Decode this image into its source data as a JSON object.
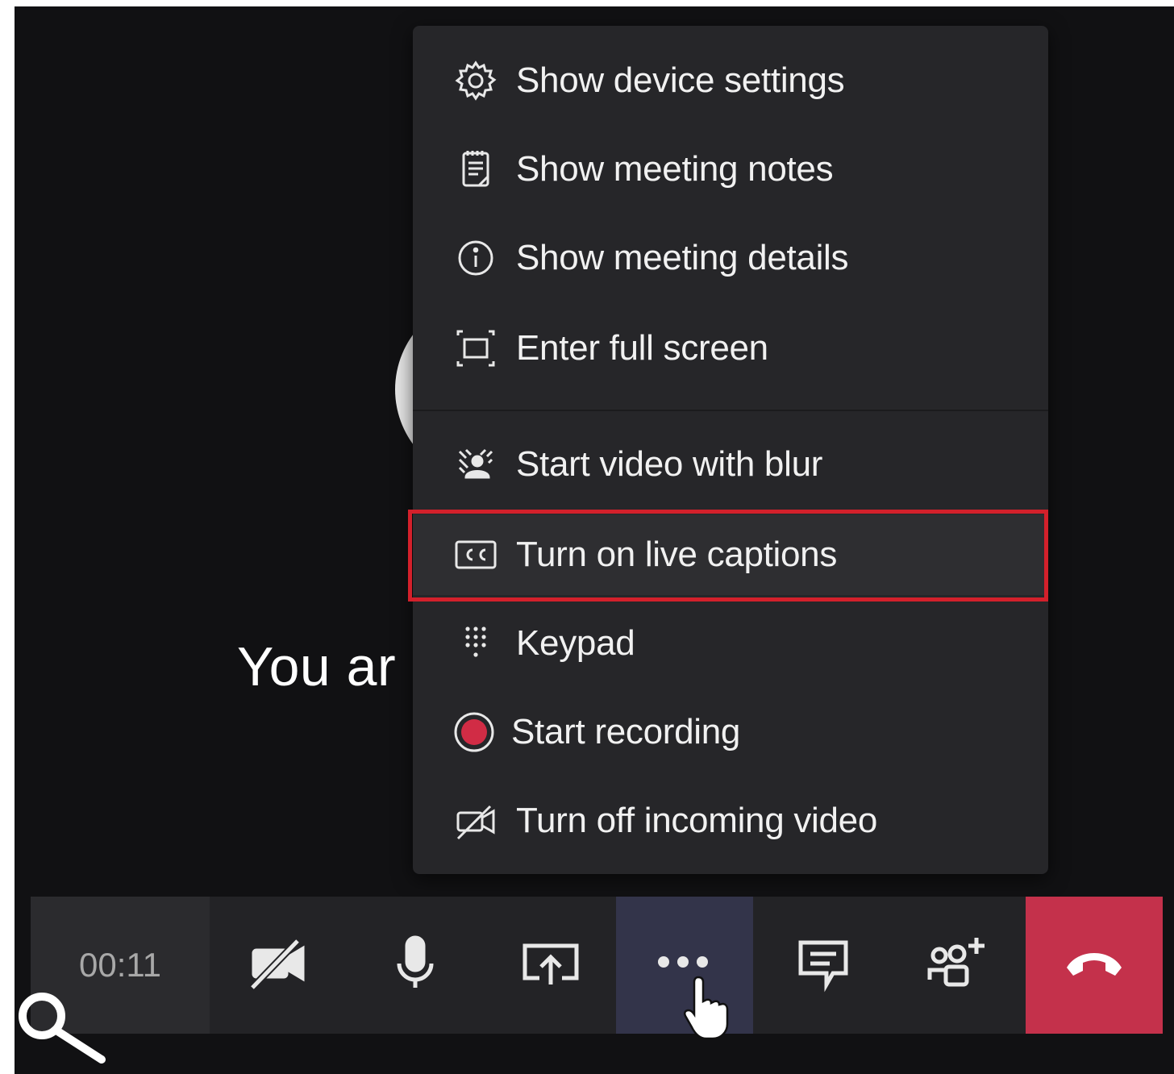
{
  "stage": {
    "waiting_text": "You ar"
  },
  "menu": {
    "items": [
      {
        "label": "Show device settings",
        "icon": "gear-icon"
      },
      {
        "label": "Show meeting notes",
        "icon": "notes-icon"
      },
      {
        "label": "Show meeting details",
        "icon": "info-icon"
      },
      {
        "label": "Enter full screen",
        "icon": "fullscreen-icon"
      },
      {
        "label": "Start video with blur",
        "icon": "blur-icon"
      },
      {
        "label": "Turn on live captions",
        "icon": "cc-icon",
        "highlighted": true
      },
      {
        "label": "Keypad",
        "icon": "keypad-icon"
      },
      {
        "label": "Start recording",
        "icon": "record-icon"
      },
      {
        "label": "Turn off incoming video",
        "icon": "video-off-icon"
      }
    ]
  },
  "toolbar": {
    "timer": "00:11",
    "buttons": [
      "camera-off-icon",
      "microphone-icon",
      "share-screen-icon",
      "more-options-icon",
      "chat-icon",
      "participants-icon",
      "hang-up-icon"
    ]
  },
  "colors": {
    "highlight_border": "#d3202b",
    "record_dot": "#d12c45",
    "hangup": "#c4314b",
    "more_active": "#33344a"
  }
}
